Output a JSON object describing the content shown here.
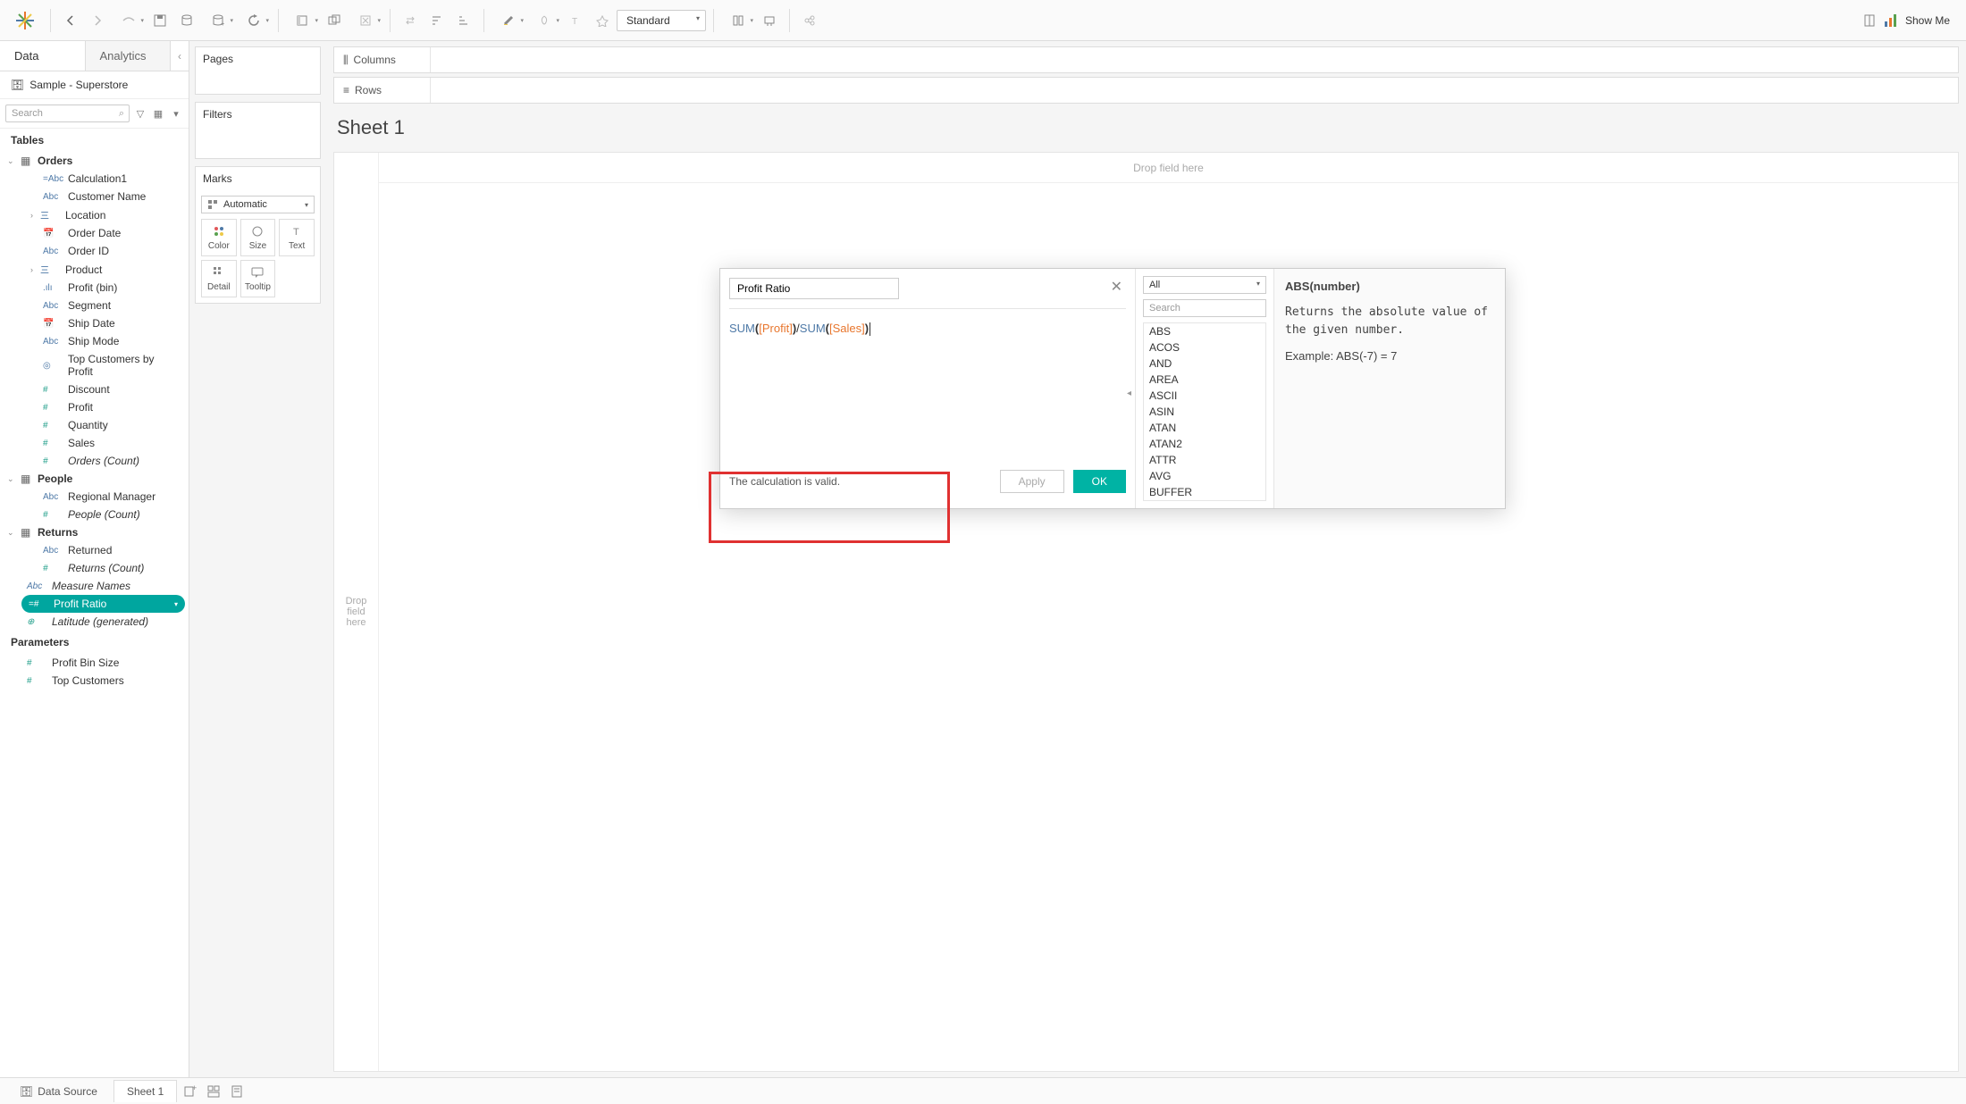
{
  "toolbar": {
    "standard_label": "Standard",
    "show_me_label": "Show Me"
  },
  "data_pane": {
    "tabs": {
      "data": "Data",
      "analytics": "Analytics"
    },
    "datasource": "Sample - Superstore",
    "search_placeholder": "Search",
    "tables_header": "Tables",
    "parameters_header": "Parameters",
    "groups": [
      {
        "name": "Orders",
        "fields": [
          {
            "icon": "=Abc",
            "cls": "blue",
            "label": "Calculation1"
          },
          {
            "icon": "Abc",
            "cls": "blue",
            "label": "Customer Name"
          },
          {
            "icon": "㆔",
            "cls": "blue",
            "label": "Location",
            "expandable": true
          },
          {
            "icon": "📅",
            "cls": "blue",
            "label": "Order Date"
          },
          {
            "icon": "Abc",
            "cls": "blue",
            "label": "Order ID"
          },
          {
            "icon": "㆔",
            "cls": "blue",
            "label": "Product",
            "expandable": true
          },
          {
            "icon": ".ılı",
            "cls": "blue",
            "label": "Profit (bin)"
          },
          {
            "icon": "Abc",
            "cls": "blue",
            "label": "Segment"
          },
          {
            "icon": "📅",
            "cls": "blue",
            "label": "Ship Date"
          },
          {
            "icon": "Abc",
            "cls": "blue",
            "label": "Ship Mode"
          },
          {
            "icon": "◎",
            "cls": "blue",
            "label": "Top Customers by Profit"
          },
          {
            "icon": "#",
            "cls": "teal",
            "label": "Discount"
          },
          {
            "icon": "#",
            "cls": "teal",
            "label": "Profit"
          },
          {
            "icon": "#",
            "cls": "teal",
            "label": "Quantity"
          },
          {
            "icon": "#",
            "cls": "teal",
            "label": "Sales"
          },
          {
            "icon": "#",
            "cls": "teal",
            "label": "Orders (Count)",
            "italic": true
          }
        ]
      },
      {
        "name": "People",
        "fields": [
          {
            "icon": "Abc",
            "cls": "blue",
            "label": "Regional Manager"
          },
          {
            "icon": "#",
            "cls": "teal",
            "label": "People (Count)",
            "italic": true
          }
        ]
      },
      {
        "name": "Returns",
        "fields": [
          {
            "icon": "Abc",
            "cls": "blue",
            "label": "Returned"
          },
          {
            "icon": "#",
            "cls": "teal",
            "label": "Returns (Count)",
            "italic": true
          }
        ]
      }
    ],
    "loose_fields": [
      {
        "icon": "Abc",
        "cls": "blue",
        "label": "Measure Names",
        "italic": true
      },
      {
        "icon": "=#",
        "cls": "teal",
        "label": "Profit Ratio",
        "selected": true
      },
      {
        "icon": "⊕",
        "cls": "teal",
        "label": "Latitude (generated)",
        "italic": true
      }
    ],
    "parameters": [
      {
        "icon": "#",
        "cls": "teal",
        "label": "Profit Bin Size"
      },
      {
        "icon": "#",
        "cls": "teal",
        "label": "Top Customers"
      }
    ]
  },
  "cards": {
    "pages": "Pages",
    "filters": "Filters",
    "marks": "Marks",
    "marks_type": "Automatic",
    "cells": [
      "Color",
      "Size",
      "Text",
      "Detail",
      "Tooltip"
    ]
  },
  "shelves": {
    "columns": "Columns",
    "rows": "Rows"
  },
  "sheet": {
    "title": "Sheet 1",
    "drop_here": "Drop field here",
    "drop_rows": "Drop\nfield\nhere"
  },
  "calc_dialog": {
    "name": "Profit Ratio",
    "formula_parts": {
      "fn1": "SUM",
      "p1": "(",
      "field1": "[Profit]",
      "p2": ")",
      "op": "/",
      "fn2": "SUM",
      "p3": "(",
      "field2": "[Sales]",
      "p4": ")"
    },
    "status": "The calculation is valid.",
    "apply": "Apply",
    "ok": "OK",
    "func_category": "All",
    "func_search_placeholder": "Search",
    "functions": [
      "ABS",
      "ACOS",
      "AND",
      "AREA",
      "ASCII",
      "ASIN",
      "ATAN",
      "ATAN2",
      "ATTR",
      "AVG",
      "BUFFER"
    ],
    "help_sig": "ABS(number)",
    "help_desc": "Returns the absolute value of the given number.",
    "help_ex": "Example: ABS(-7) = 7"
  },
  "bottom": {
    "data_source": "Data Source",
    "sheet": "Sheet 1"
  }
}
